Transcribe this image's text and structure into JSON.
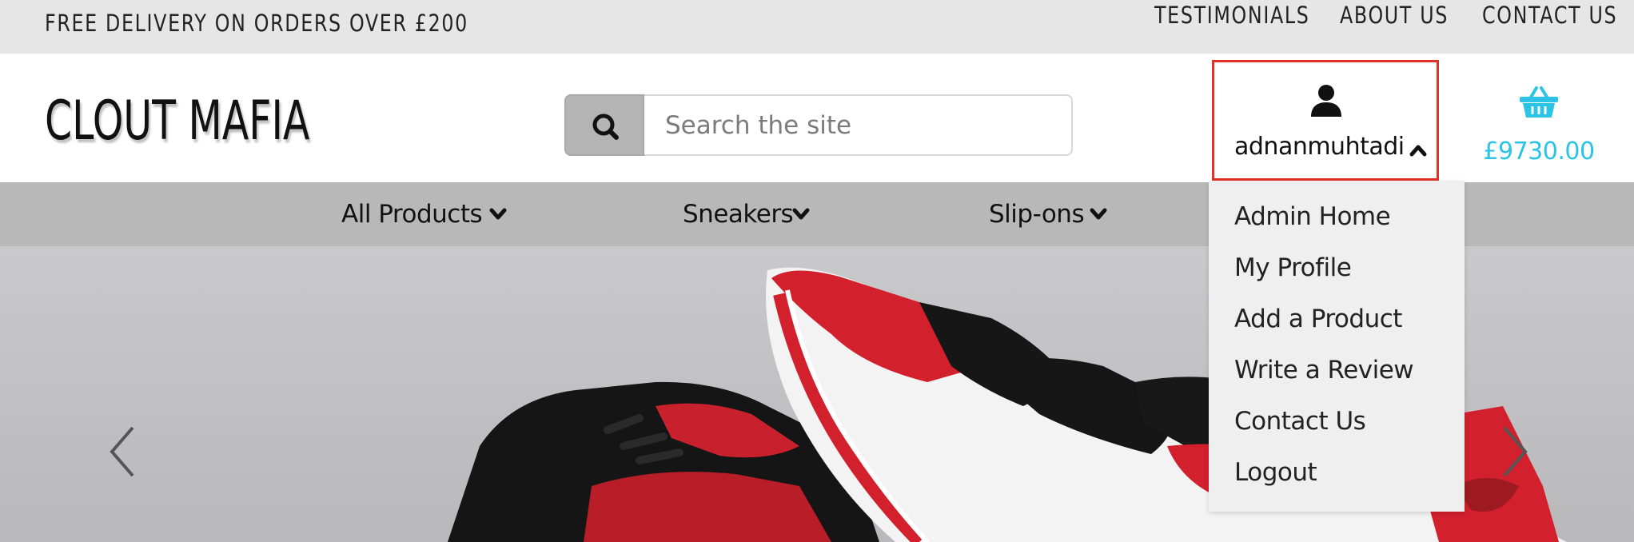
{
  "topbar": {
    "promo": "FREE DELIVERY ON ORDERS OVER £200",
    "links": [
      "TESTIMONIALS",
      "ABOUT US",
      "CONTACT US"
    ]
  },
  "header": {
    "logo": "CLOUT MAFIA",
    "search": {
      "placeholder": "Search the site",
      "value": "",
      "icon": "search-icon"
    },
    "account": {
      "icon": "user-icon",
      "username": "adnanmuhtadi",
      "caret": "chevron-up-icon",
      "highlight_color": "#e53027"
    },
    "cart": {
      "icon": "basket-icon",
      "total": "£9730.00",
      "color": "#2bc3e6"
    }
  },
  "nav": {
    "items": [
      {
        "label": "All Products",
        "icon": "chevron-down-icon"
      },
      {
        "label": "Sneakers",
        "icon": "chevron-down-icon"
      },
      {
        "label": "Slip-ons",
        "icon": "chevron-down-icon"
      }
    ]
  },
  "account_menu": {
    "items": [
      "Admin Home",
      "My Profile",
      "Add a Product",
      "Write a Review",
      "Contact Us",
      "Logout"
    ]
  },
  "hero": {
    "prev_icon": "chevron-left-icon",
    "next_icon": "chevron-right-icon",
    "image": "red-black-white-sneakers"
  }
}
